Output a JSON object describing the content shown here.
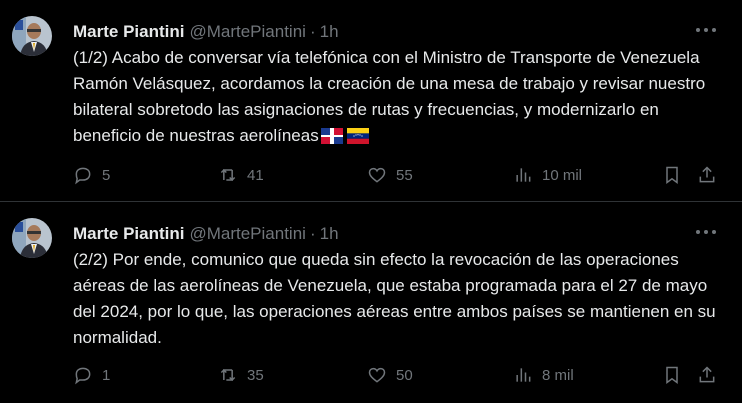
{
  "tweets": [
    {
      "author_name": "Marte Piantini",
      "handle": "@MartePiantini",
      "time": "1h",
      "text": "(1/2) Acabo de conversar vía telefónica con el Ministro de Transporte de Venezuela Ramón Velásquez, acordamos la creación de una mesa de trabajo y revisar nuestro bilateral sobretodo las asignaciones de rutas y frecuencias, y modernizarlo en beneficio de nuestras aerolíneas",
      "flags": [
        "flag-dominican-republic",
        "flag-venezuela"
      ],
      "replies": "5",
      "reposts": "41",
      "likes": "55",
      "views": "10 mil"
    },
    {
      "author_name": "Marte Piantini",
      "handle": "@MartePiantini",
      "time": "1h",
      "text": "(2/2) Por ende, comunico que queda sin efecto la revocación de las operaciones aéreas de las aerolíneas de Venezuela, que estaba programada para el 27 de mayo del 2024, por lo que, las operaciones aéreas entre ambos países se mantienen en su normalidad.",
      "flags": [],
      "replies": "1",
      "reposts": "35",
      "likes": "50",
      "views": "8 mil"
    }
  ],
  "icons": {
    "reply": "reply-icon",
    "repost": "repost-icon",
    "like": "heart-icon",
    "views": "analytics-icon",
    "bookmark": "bookmark-icon",
    "share": "share-icon",
    "more": "more-icon"
  },
  "colors": {
    "background": "#000000",
    "text": "#e7e9ea",
    "muted": "#71767b",
    "divider": "#2f3336"
  }
}
